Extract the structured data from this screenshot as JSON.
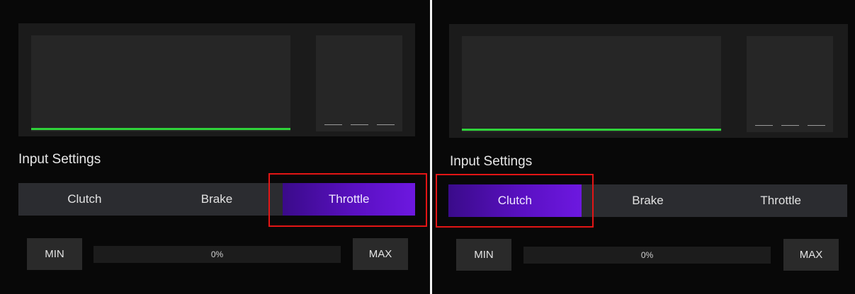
{
  "panels": [
    {
      "section_title": "Input Settings",
      "tabs": [
        {
          "label": "Clutch",
          "active": false
        },
        {
          "label": "Brake",
          "active": false
        },
        {
          "label": "Throttle",
          "active": true
        }
      ],
      "min_label": "MIN",
      "max_label": "MAX",
      "progress_value": 0,
      "progress_text": "0%"
    },
    {
      "section_title": "Input Settings",
      "tabs": [
        {
          "label": "Clutch",
          "active": true
        },
        {
          "label": "Brake",
          "active": false
        },
        {
          "label": "Throttle",
          "active": false
        }
      ],
      "min_label": "MIN",
      "max_label": "MAX",
      "progress_value": 0,
      "progress_text": "0%"
    }
  ],
  "colors": {
    "accent_gradient_start": "#3a0b8a",
    "accent_gradient_end": "#6d18e0",
    "input_line": "#2fd33a",
    "highlight_border": "#e31515"
  }
}
